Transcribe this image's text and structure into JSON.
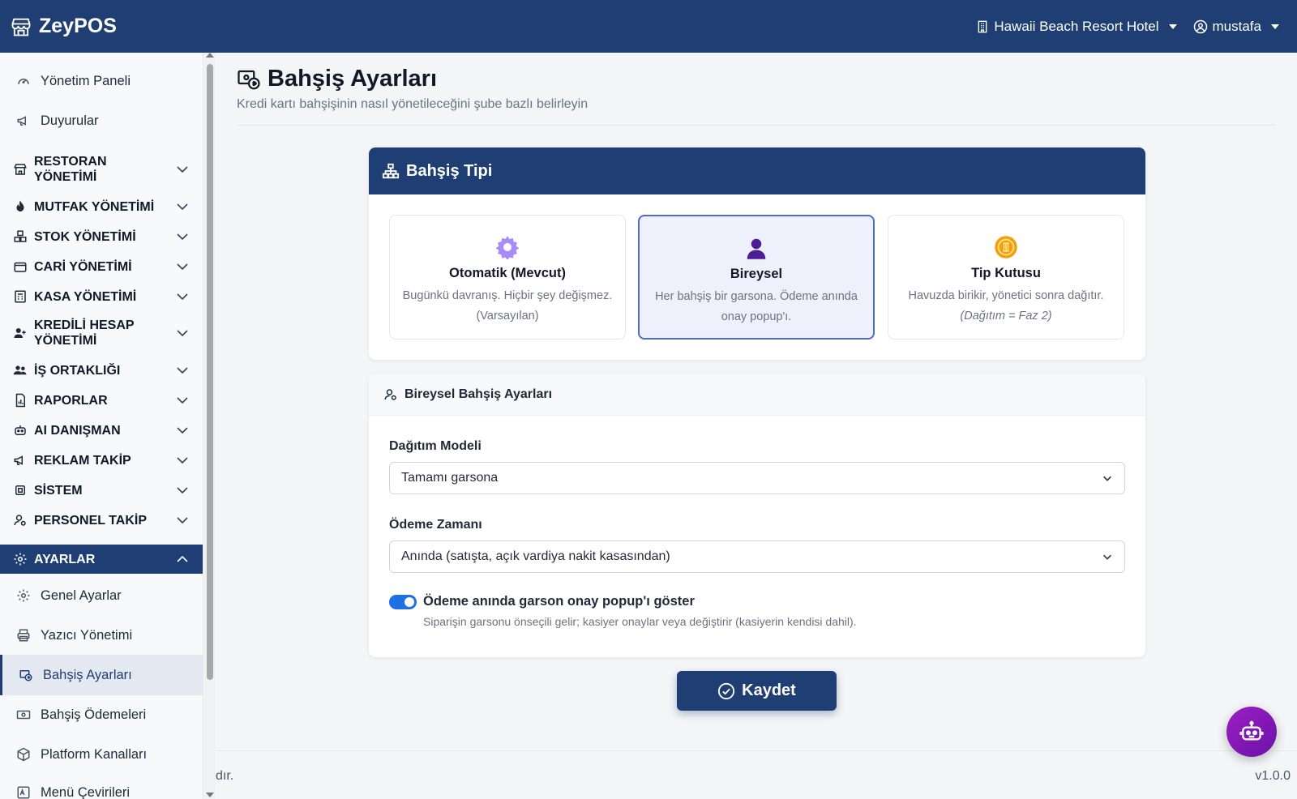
{
  "app": {
    "brand": "ZeyPOS",
    "hotel": "Hawaii Beach Resort Hotel",
    "user": "mustafa"
  },
  "sidebar": {
    "links_top": [
      {
        "label": "Yönetim Paneli",
        "icon": "gauge-icon"
      },
      {
        "label": "Duyurular",
        "icon": "megaphone-icon"
      }
    ],
    "groups": [
      {
        "label": "RESTORAN YÖNETİMİ",
        "icon": "store-icon"
      },
      {
        "label": "MUTFAK YÖNETİMİ",
        "icon": "fire-icon"
      },
      {
        "label": "STOK YÖNETİMİ",
        "icon": "boxes-icon"
      },
      {
        "label": "CARİ YÖNETİMİ",
        "icon": "wallet-icon"
      },
      {
        "label": "KASA YÖNETİMİ",
        "icon": "calculator-icon"
      },
      {
        "label": "KREDİLİ HESAP YÖNETİMİ",
        "icon": "user-credit-icon"
      },
      {
        "label": "İŞ ORTAKLIĞI",
        "icon": "people-icon"
      },
      {
        "label": "RAPORLAR",
        "icon": "report-icon"
      },
      {
        "label": "AI DANIŞMAN",
        "icon": "robot-icon"
      },
      {
        "label": "REKLAM TAKİP",
        "icon": "megaphone-icon"
      },
      {
        "label": "SİSTEM",
        "icon": "cpu-icon"
      },
      {
        "label": "PERSONEL TAKİP",
        "icon": "user-gear-icon"
      },
      {
        "label": "AYARLAR",
        "icon": "gear-icon"
      }
    ],
    "sub": [
      {
        "label": "Genel Ayarlar",
        "icon": "gear-icon"
      },
      {
        "label": "Yazıcı Yönetimi",
        "icon": "printer-icon"
      },
      {
        "label": "Bahşiş Ayarları",
        "icon": "tip-settings-icon"
      },
      {
        "label": "Bahşiş Ödemeleri",
        "icon": "cash-icon"
      },
      {
        "label": "Platform Kanalları",
        "icon": "box-icon"
      },
      {
        "label": "Menü Çevirileri",
        "icon": "translate-icon"
      }
    ]
  },
  "page": {
    "title": "Bahşiş Ayarları",
    "subtitle": "Kredi kartı bahşişinin nasıl yönetileceğini şube bazlı belirleyin"
  },
  "tip_type": {
    "header": "Bahşiş Tipi",
    "options": [
      {
        "title": "Otomatik (Mevcut)",
        "desc1": "Bugünkü davranış. Hiçbir şey değişmez.",
        "desc2": "(Varsayılan)",
        "selected": false,
        "icon": "gear-icon",
        "color": "#a78bfa"
      },
      {
        "title": "Bireysel",
        "desc1": "Her bahşiş bir garsona. Ödeme anında",
        "desc2": "onay popup'ı.",
        "selected": true,
        "icon": "person-icon",
        "color": "#4c1d95"
      },
      {
        "title": "Tip Kutusu",
        "desc1": "Havuzda birikir, yönetici sonra dağıtır.",
        "desc2": "(Dağıtım = Faz 2)",
        "selected": false,
        "icon": "coin-icon",
        "color": "#f59e0b"
      }
    ]
  },
  "settings": {
    "header": "Bireysel Bahşiş Ayarları",
    "dist_label": "Dağıtım Modeli",
    "dist_value": "Tamamı garsona",
    "pay_label": "Ödeme Zamanı",
    "pay_value": "Anında (satışta, açık vardiya nakit kasasından)",
    "toggle_label": "Ödeme anında garson onay popup'ı göster",
    "toggle_on": true,
    "toggle_help": "Siparişin garsonu önseçili gelir; kasiyer onaylar veya değiştirir (kasiyerin kendisi dahil)."
  },
  "save_label": "Kaydet",
  "footer": {
    "left": "dır.",
    "version": "v1.0.0"
  },
  "colors": {
    "navy": "#1f3f74",
    "accent": "#4a6cd1",
    "toggle": "#1f6fe5",
    "bot": "#9d1fc4"
  }
}
